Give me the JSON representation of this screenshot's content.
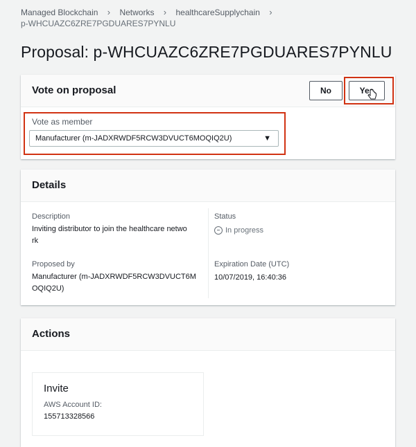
{
  "breadcrumb": {
    "items": [
      "Managed Blockchain",
      "Networks",
      "healthcareSupplychain",
      "p-WHCUAZC6ZRE7PGDUARES7PYNLU"
    ]
  },
  "page_title": "Proposal: p-WHCUAZC6ZRE7PGDUARES7PYNLU",
  "vote_panel": {
    "title": "Vote on proposal",
    "no_label": "No",
    "yes_label": "Yes",
    "member_label": "Vote as member",
    "member_value": "Manufacturer (m-JADXRWDF5RCW3DVUCT6MOQIQ2U)"
  },
  "details": {
    "title": "Details",
    "description_label": "Description",
    "description_value_line1": "Inviting distributor to join the healthcare netwo",
    "description_value_line2": "rk",
    "status_label": "Status",
    "status_value": "In progress",
    "proposed_by_label": "Proposed by",
    "proposed_by_line1": "Manufacturer (m-JADXRWDF5RCW3DVUCT6M",
    "proposed_by_line2": "OQIQ2U)",
    "expiration_label": "Expiration Date (UTC)",
    "expiration_value": "10/07/2019, 16:40:36"
  },
  "actions": {
    "title": "Actions",
    "card_title": "Invite",
    "account_label": "AWS Account ID:",
    "account_value": "155713328566"
  },
  "colors": {
    "highlight": "#d13212",
    "background": "#f2f3f3",
    "panel_header": "#fafafa"
  },
  "icons": [
    "chevron-right-icon",
    "dropdown-caret-icon",
    "in-progress-status-icon",
    "pointer-cursor-icon"
  ]
}
